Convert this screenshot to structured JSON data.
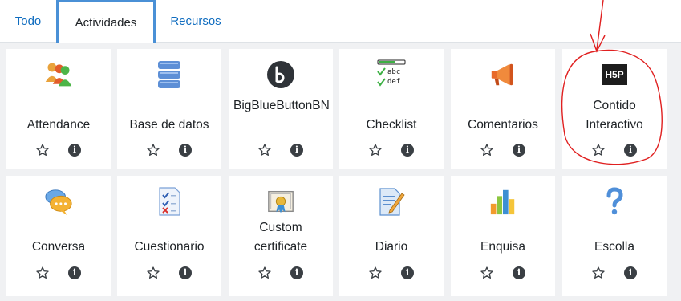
{
  "tabs": [
    {
      "label": "Todo"
    },
    {
      "label": "Actividades"
    },
    {
      "label": "Recursos"
    }
  ],
  "active_tab": "Actividades",
  "modules": [
    {
      "label": "Attendance",
      "icon": "attendance-icon"
    },
    {
      "label": "Base de datos",
      "icon": "database-icon"
    },
    {
      "label": "BigBlueButtonBN",
      "icon": "bigbluebutton-icon"
    },
    {
      "label": "Checklist",
      "icon": "checklist-icon"
    },
    {
      "label": "Comentarios",
      "icon": "megaphone-icon"
    },
    {
      "label": "Contido Interactivo",
      "icon": "h5p-icon",
      "icon_text": "H5P"
    },
    {
      "label": "Conversa",
      "icon": "chat-bubbles-icon"
    },
    {
      "label": "Cuestionario",
      "icon": "quiz-icon"
    },
    {
      "label": "Custom certificate",
      "icon": "certificate-icon"
    },
    {
      "label": "Diario",
      "icon": "journal-icon"
    },
    {
      "label": "Enquisa",
      "icon": "bar-chart-icon"
    },
    {
      "label": "Escolla",
      "icon": "question-mark-icon"
    }
  ],
  "checklist_icon_text": {
    "line1": "abc",
    "line2": "def"
  },
  "colors": {
    "link": "#0f6cbf",
    "active_tab_border": "#4a90d6",
    "annotation": "#e02020",
    "grid_bg": "#f0f1f3"
  }
}
